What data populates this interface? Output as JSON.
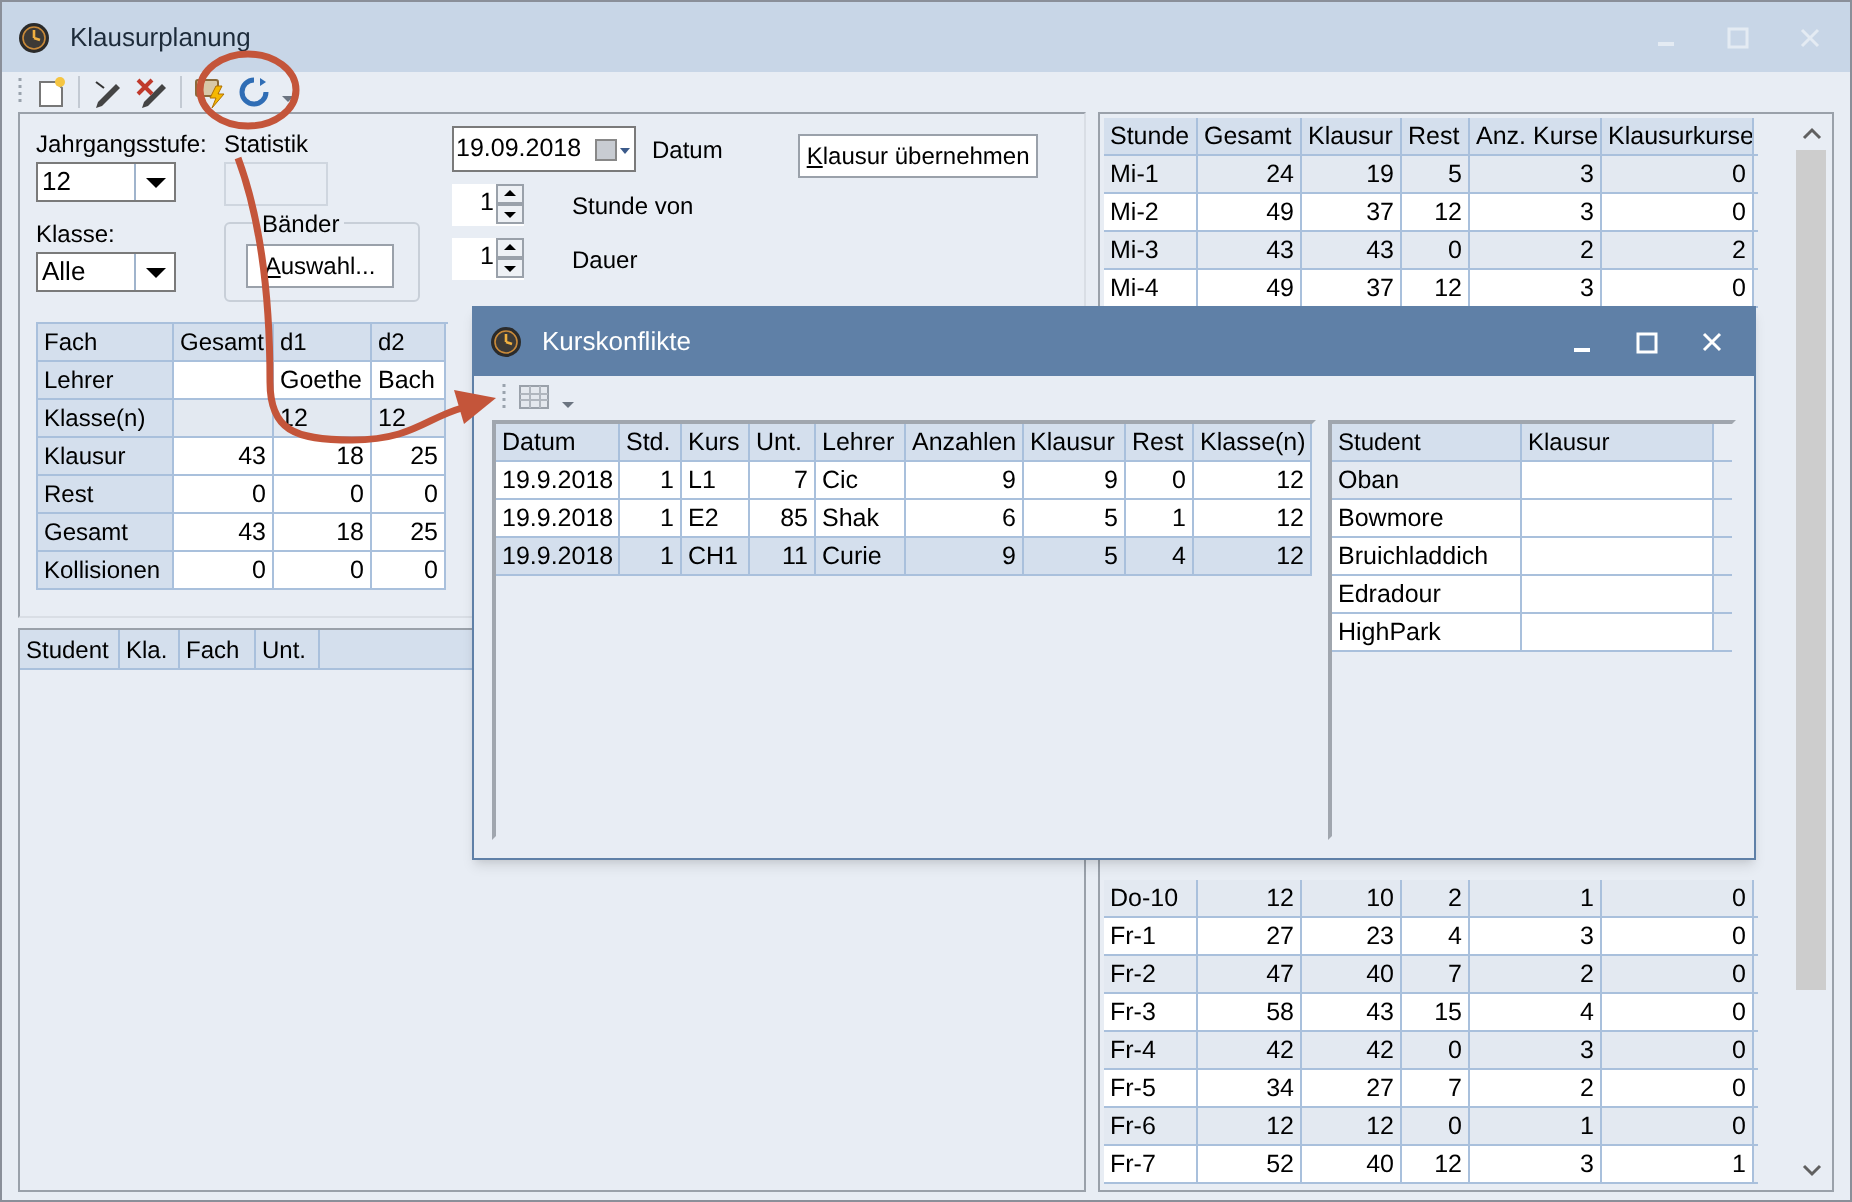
{
  "window": {
    "title": "Klausurplanung"
  },
  "form": {
    "jahrgangsstufe": {
      "label": "Jahrgangsstufe:",
      "value": "12"
    },
    "klasse": {
      "label": "Klasse:",
      "value": "Alle"
    },
    "statistik": {
      "label": "Statistik"
    },
    "baender": {
      "label": "Bänder",
      "button": "Auswahl..."
    },
    "datum": {
      "value": "19.09.2018",
      "label": "Datum"
    },
    "stunde_von": {
      "value": "1",
      "label": "Stunde von"
    },
    "dauer": {
      "value": "1",
      "label": "Dauer"
    },
    "apply_button": "Klausur übernehmen"
  },
  "stats_table": {
    "columns": [
      "Fach",
      "Gesamt",
      "d1",
      "d2"
    ],
    "rows": [
      {
        "kind": "text",
        "shaded": false,
        "cells": [
          "Lehrer",
          "",
          "Goethe",
          "Bach"
        ]
      },
      {
        "kind": "text",
        "shaded": true,
        "cells": [
          "Klasse(n)",
          "",
          "12",
          "12"
        ]
      },
      {
        "kind": "number",
        "shaded": false,
        "cells": [
          "Klausur",
          "43",
          "18",
          "25"
        ]
      },
      {
        "kind": "number",
        "shaded": false,
        "cells": [
          "Rest",
          "0",
          "0",
          "0"
        ]
      },
      {
        "kind": "number",
        "shaded": false,
        "cells": [
          "Gesamt",
          "43",
          "18",
          "25"
        ]
      },
      {
        "kind": "number",
        "shaded": false,
        "cells": [
          "Kollisionen",
          "0",
          "0",
          "0"
        ]
      }
    ]
  },
  "student_table": {
    "columns": [
      "Student",
      "Kla.",
      "Fach",
      "Unt."
    ]
  },
  "hours_table": {
    "columns": [
      "Stunde",
      "Gesamt",
      "Klausur",
      "Rest",
      "Anz. Kurse",
      "Klausurkurse"
    ],
    "upper_rows": [
      [
        "Mi-1",
        "24",
        "19",
        "5",
        "3",
        "0"
      ],
      [
        "Mi-2",
        "49",
        "37",
        "12",
        "3",
        "0"
      ],
      [
        "Mi-3",
        "43",
        "43",
        "0",
        "2",
        "2"
      ],
      [
        "Mi-4",
        "49",
        "37",
        "12",
        "3",
        "0"
      ]
    ],
    "lower_rows": [
      [
        "Do-10",
        "12",
        "10",
        "2",
        "1",
        "0"
      ],
      [
        "Fr-1",
        "27",
        "23",
        "4",
        "3",
        "0"
      ],
      [
        "Fr-2",
        "47",
        "40",
        "7",
        "2",
        "0"
      ],
      [
        "Fr-3",
        "58",
        "43",
        "15",
        "4",
        "0"
      ],
      [
        "Fr-4",
        "42",
        "42",
        "0",
        "3",
        "0"
      ],
      [
        "Fr-5",
        "34",
        "27",
        "7",
        "2",
        "0"
      ],
      [
        "Fr-6",
        "12",
        "12",
        "0",
        "1",
        "0"
      ],
      [
        "Fr-7",
        "52",
        "40",
        "12",
        "3",
        "1"
      ]
    ]
  },
  "dialog": {
    "title": "Kurskonflikte",
    "conflicts": {
      "columns": [
        "Datum",
        "Std.",
        "Kurs",
        "Unt.",
        "Lehrer",
        "Anzahlen",
        "Klausur",
        "Rest",
        "Klasse(n)"
      ],
      "rows": [
        {
          "cells": [
            "19.9.2018",
            "1",
            "L1",
            "7",
            "Cic",
            "9",
            "9",
            "0",
            "12"
          ],
          "selected": false
        },
        {
          "cells": [
            "19.9.2018",
            "1",
            "E2",
            "85",
            "Shak",
            "6",
            "5",
            "1",
            "12"
          ],
          "selected": false
        },
        {
          "cells": [
            "19.9.2018",
            "1",
            "CH1",
            "11",
            "Curie",
            "9",
            "5",
            "4",
            "12"
          ],
          "selected": true
        }
      ]
    },
    "students": {
      "columns": [
        "Student",
        "Klausur"
      ],
      "rows": [
        {
          "name": "Oban",
          "klausur": "",
          "selected": true
        },
        {
          "name": "Bowmore",
          "klausur": "",
          "selected": false
        },
        {
          "name": "Bruichladdich",
          "klausur": "",
          "selected": false
        },
        {
          "name": "Edradour",
          "klausur": "",
          "selected": false
        },
        {
          "name": "HighPark",
          "klausur": "",
          "selected": false
        }
      ]
    }
  }
}
